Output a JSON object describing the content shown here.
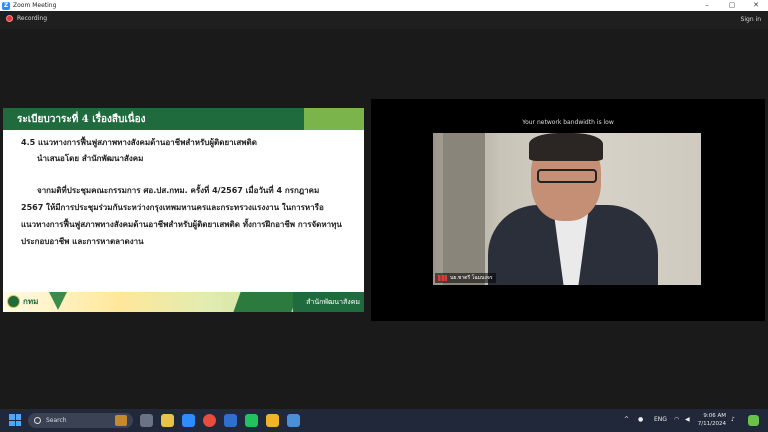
{
  "window": {
    "title": "Zoom Meeting",
    "minimize": "–",
    "maximize": "▢",
    "close": "✕"
  },
  "meeting": {
    "recording_label": "Recording",
    "signin_label": "Sign in"
  },
  "slide": {
    "header": "ระเบียบวาระที่ 4  เรื่องสืบเนื่อง",
    "subtitle": "4.5 แนวทางการฟื้นฟูสภาพทางสังคมด้านอาชีพสำหรับผู้ติดยาเสพติด",
    "presenter": "นำเสนอโดย สำนักพัฒนาสังคม",
    "paragraph_line1": "จากมติที่ประชุมคณะกรรมการ ศอ.ปส.กทม. ครั้งที่ 4/2567 เมื่อวันที่ 4 กรกฎาคม",
    "paragraph_rest": "2567 ให้มีการประชุมร่วมกันระหว่างกรุงเทพมหานครและกระทรวงแรงงาน ในการหารือ แนวทางการฟื้นฟูสภาพทางสังคมด้านอาชีพสำหรับผู้ติดยาเสพติด ทั้งการฝึกอาชีพ การจัดหาทุนประกอบอาชีพ และการหาตลาดงาน",
    "footer_logo_text": "กทม",
    "footer_department": "สำนักพัฒนาสังคม"
  },
  "video": {
    "bandwidth_notice": "Your network bandwidth is low",
    "participant_name": "นย.ชาตรี โฉมนงจร"
  },
  "taskbar": {
    "search_placeholder": "Search",
    "language": "ENG",
    "time": "9:06 AM",
    "date": "7/11/2024"
  },
  "colors": {
    "slide_green": "#1f6b3e",
    "zoom_blue": "#2d8cff",
    "recording_red": "#e03a3a"
  }
}
